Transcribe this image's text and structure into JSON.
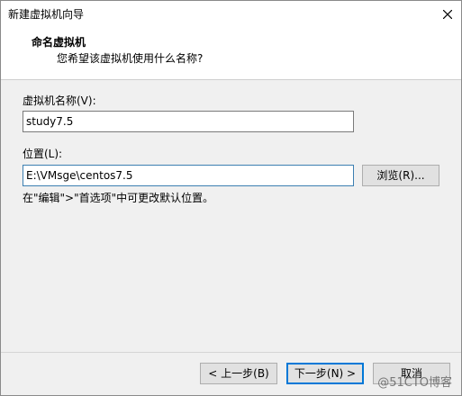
{
  "window": {
    "title": "新建虚拟机向导"
  },
  "header": {
    "title": "命名虚拟机",
    "subtitle": "您希望该虚拟机使用什么名称?"
  },
  "form": {
    "name_label": "虚拟机名称(V):",
    "name_value": "study7.5",
    "location_label": "位置(L):",
    "location_value": "E:\\VMsge\\centos7.5",
    "browse_label": "浏览(R)...",
    "hint": "在\"编辑\">\"首选项\"中可更改默认位置。"
  },
  "footer": {
    "back_label": "< 上一步(B)",
    "next_label": "下一步(N) >",
    "cancel_label": "取消"
  },
  "watermark": "@51CTO博客"
}
